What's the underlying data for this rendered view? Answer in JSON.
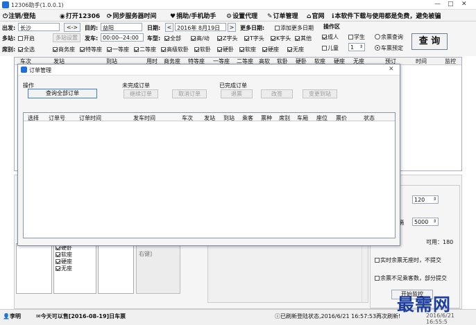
{
  "window": {
    "title": "12306助手(1.0.0.1)",
    "controls": {
      "minimize": "—",
      "maximize": "□",
      "close": "✕"
    }
  },
  "menu": [
    {
      "icon": "⏻",
      "label": "注销/登陆"
    },
    {
      "icon": "◉",
      "label": "打开12306"
    },
    {
      "icon": "⟳",
      "label": "同步服务器时间"
    },
    {
      "icon": "♥",
      "label": "捐助/手机助手"
    },
    {
      "icon": "⚙",
      "label": "设置代理"
    },
    {
      "icon": "✎",
      "label": "订单管理"
    },
    {
      "icon": "⌂",
      "label": "官网"
    },
    {
      "icon": "ℹ",
      "label": "本软件下载与使用都是免费，避免被骗"
    }
  ],
  "query": {
    "from_label": "出发:",
    "from_value": "长沙",
    "swap": "<->",
    "to_label": "目的:",
    "to_value": "益阳",
    "date_label": "日期:",
    "date_prev": "<",
    "date_value": "2016年 8月19日",
    "date_next": ">",
    "more_dates": "更多日期:",
    "add_more_dates": "添加更多日期",
    "op_area": "操作区",
    "multi_station_label": "多站:",
    "multi_station_enable": "开启",
    "multi_station_btn": "多站设置",
    "depart_label": "发车:",
    "depart_range": "00:00--24:00",
    "train_type_label": "车型:",
    "train_types": [
      "全部",
      "高/动",
      "Z字头",
      "T字头",
      "K字头",
      "其他"
    ],
    "seat_label": "席别:",
    "seats": [
      "全选",
      "商务座",
      "特等座",
      "一等座",
      "二等座",
      "高级软卧",
      "软卧",
      "硬卧",
      "软座",
      "硬座",
      "无座"
    ],
    "adult": "成人",
    "student": "学生",
    "child": "儿童",
    "child_count": "1",
    "remain_query": "余票查询",
    "ticket_lock": "车票预定",
    "query_btn": "查 询"
  },
  "main_table": {
    "headers": [
      "车次",
      "发站",
      "到站",
      "用时",
      "商务座",
      "特等座",
      "一等座",
      "二等座",
      "高软",
      "软卧",
      "硬卧",
      "软座",
      "硬座",
      "无座",
      "预订",
      "时间",
      "监控"
    ]
  },
  "order_dialog": {
    "title": "订单管理",
    "close": "✕",
    "ops_group": "操作",
    "query_all": "查询全部订单",
    "incomplete_group": "未完成订单",
    "continue_pay": "继续订单",
    "cancel_order": "取消订单",
    "complete_group": "已完成订单",
    "refund": "退票",
    "change": "改签",
    "change_station": "变更到站",
    "headers": [
      "选择",
      "订单号",
      "订单时间",
      "发车时间",
      "车次",
      "发站",
      "到站",
      "乘客",
      "票种",
      "席别",
      "车厢",
      "座位",
      "票价",
      "状态"
    ]
  },
  "bottom": {
    "seat_list": [
      "硬卧",
      "软座",
      "硬座",
      "无座"
    ],
    "right_label": "右键]",
    "spin1": "120",
    "spin2": "5000",
    "interval": "隔",
    "available": "可用：180",
    "a_suffix": "a",
    "opt1": "实时余票无座时，不提交",
    "opt2": "余票不足乘客数，部分提交",
    "start_monitor": "开始监控"
  },
  "status": {
    "user": "李明",
    "presale": "今天可以售[2016-08-19]日车票",
    "refresh": "已刷新登陆状态,2016/6/21 16:57:53再次刷新!",
    "clock": "2016/6/21 16:55:5"
  },
  "watermark": "最需网"
}
